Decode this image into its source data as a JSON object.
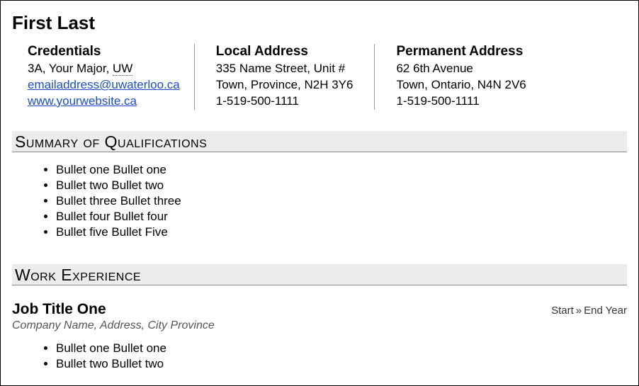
{
  "name": "First Last",
  "credentials": {
    "title": "Credentials",
    "line1a": "3A, Your Major, ",
    "line1b": "UW",
    "email": "emailaddress@uwaterloo.ca",
    "website": "www.yourwebsite.ca"
  },
  "local": {
    "title": "Local Address",
    "line1": "335 Name Street, Unit #",
    "line2": "Town, Province, N2H 3Y6",
    "line3": "1-519-500-1111"
  },
  "permanent": {
    "title": "Permanent Address",
    "line1": "62 6th Avenue",
    "line2": "Town, Ontario, N4N 2V6",
    "line3": "1-519-500-1111"
  },
  "sections": {
    "summary_title": "Summary of Qualifications",
    "work_title": "Work Experience"
  },
  "summary_bullets": [
    "Bullet one Bullet one",
    "Bullet two Bullet two",
    "Bullet three Bullet three",
    "Bullet four Bullet four",
    "Bullet five Bullet Five"
  ],
  "job1": {
    "title": "Job Title One",
    "date_start": "Start",
    "date_sep": "»",
    "date_end": "End Year",
    "company": "Company Name, Address, City Province",
    "bullets": [
      "Bullet one Bullet one",
      "Bullet two Bullet two"
    ]
  }
}
